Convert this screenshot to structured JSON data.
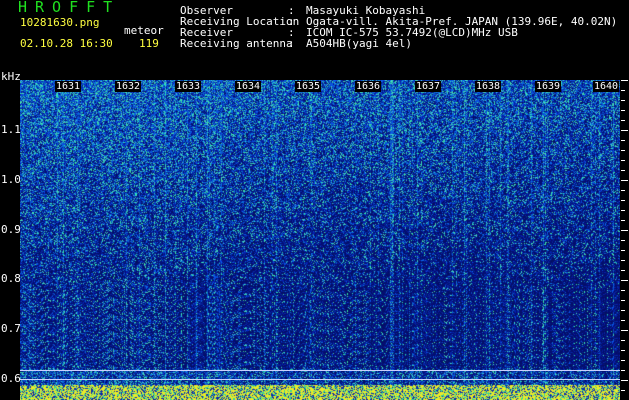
{
  "header": {
    "app_name": "HROFFT",
    "filename": "10281630.png",
    "datetime": "02.10.28 16:30",
    "meteor_label": "meteor",
    "meteor_count": "119",
    "info": [
      {
        "label": "Observer",
        "value": "Masayuki Kobayashi"
      },
      {
        "label": "Receiving Location",
        "value": "Ogata-vill. Akita-Pref. JAPAN (139.96E, 40.02N)"
      },
      {
        "label": "Receiver",
        "value": "ICOM IC-575 53.7492(@LCD)MHz USB"
      },
      {
        "label": "Receiving antenna",
        "value": "A504HB(yagi 4el)"
      }
    ],
    "colon": ":"
  },
  "axis": {
    "unit": "kHz",
    "ticks": [
      "1.1",
      "1.0",
      "0.9",
      "0.8",
      "0.7",
      "0.6"
    ]
  },
  "minute_labels": [
    "1631",
    "1632",
    "1633",
    "1634",
    "1635",
    "1636",
    "1637",
    "1638",
    "1639",
    "1640"
  ],
  "colors": {
    "background": "#000000",
    "spectrum_low": "#071078",
    "spectrum_mid": "#1030c8",
    "spectrum_high": "#30d0c0",
    "signal": "#ffff40",
    "logo": "#20e020"
  }
}
